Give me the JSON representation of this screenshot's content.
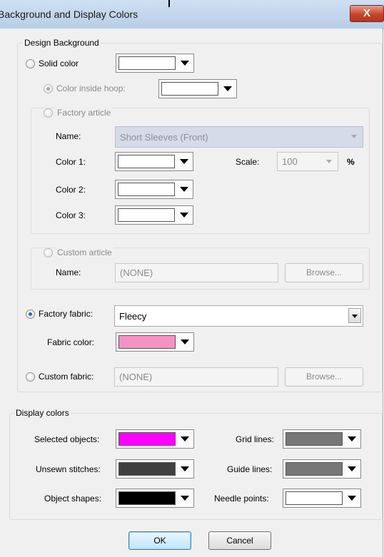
{
  "window": {
    "title": "Background and Display Colors",
    "close_glyph": "X"
  },
  "design_background": {
    "legend": "Design Background",
    "solid_color": {
      "label": "Solid color",
      "selected": false,
      "swatch": "#ffffff"
    },
    "color_inside_hoop": {
      "label": "Color inside hoop:",
      "selected": true,
      "enabled": false,
      "swatch": "#ffffff"
    },
    "factory_article": {
      "label": "Factory article",
      "selected": false,
      "name_label": "Name:",
      "name_value": "Short Sleeves (Front)",
      "color1_label": "Color 1:",
      "color2_label": "Color 2:",
      "color3_label": "Color 3:",
      "scale_label": "Scale:",
      "scale_value": "100",
      "scale_unit": "%"
    },
    "custom_article": {
      "label": "Custom article",
      "selected": false,
      "name_label": "Name:",
      "name_value": "(NONE)",
      "browse_label": "Browse..."
    },
    "factory_fabric": {
      "label": "Factory fabric:",
      "selected": true,
      "value": "Fleecy",
      "fabric_color_label": "Fabric color:",
      "fabric_color": "#f592c4"
    },
    "custom_fabric": {
      "label": "Custom fabric:",
      "selected": false,
      "value": "(NONE)",
      "browse_label": "Browse..."
    }
  },
  "display_colors": {
    "legend": "Display colors",
    "selected_objects": {
      "label": "Selected objects:",
      "color": "#ff00ff"
    },
    "unsewn_stitches": {
      "label": "Unsewn stitches:",
      "color": "#404040"
    },
    "object_shapes": {
      "label": "Object shapes:",
      "color": "#000000"
    },
    "grid_lines": {
      "label": "Grid lines:",
      "color": "#777777"
    },
    "guide_lines": {
      "label": "Guide lines:",
      "color": "#777777"
    },
    "needle_points": {
      "label": "Needle points:",
      "color": "#ffffff"
    }
  },
  "buttons": {
    "ok": "OK",
    "cancel": "Cancel"
  }
}
